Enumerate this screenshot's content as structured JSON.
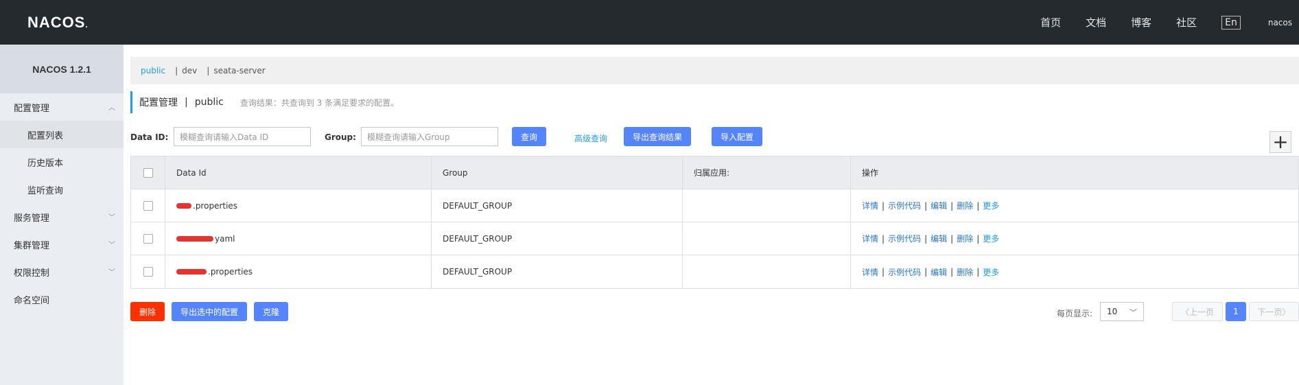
{
  "header": {
    "logo_text": "NACOS",
    "logo_dot": ".",
    "nav": [
      "首页",
      "文档",
      "博客",
      "社区"
    ],
    "lang": "En",
    "user": "nacos"
  },
  "sidebar": {
    "title": "NACOS 1.2.1",
    "items": [
      {
        "label": "配置管理",
        "level": 0,
        "expanded": true
      },
      {
        "label": "配置列表",
        "level": 1,
        "active": true
      },
      {
        "label": "历史版本",
        "level": 1
      },
      {
        "label": "监听查询",
        "level": 1
      },
      {
        "label": "服务管理",
        "level": 0
      },
      {
        "label": "集群管理",
        "level": 0
      },
      {
        "label": "权限控制",
        "level": 0
      },
      {
        "label": "命名空间",
        "level": 0
      }
    ]
  },
  "namespaces": {
    "items": [
      "public",
      "dev",
      "seata-server"
    ],
    "active": "public",
    "separator": "|"
  },
  "page": {
    "title": "配置管理",
    "bar": "|",
    "namespace": "public",
    "result_desc": "查询结果：共查询到 3 条满足要求的配置。"
  },
  "search": {
    "data_id_label": "Data ID:",
    "data_id_placeholder": "模糊查询请输入Data ID",
    "group_label": "Group:",
    "group_placeholder": "模糊查询请输入Group",
    "query_btn": "查询",
    "advanced_link": "高级查询",
    "export_btn": "导出查询结果",
    "import_btn": "导入配置",
    "add_icon": "+"
  },
  "table": {
    "headers": [
      "Data Id",
      "Group",
      "归属应用:",
      "操作"
    ],
    "rows": [
      {
        "data_id_suffix": ".properties",
        "group": "DEFAULT_GROUP",
        "app": ""
      },
      {
        "data_id_suffix": "yaml",
        "group": "DEFAULT_GROUP",
        "app": ""
      },
      {
        "data_id_suffix": ".properties",
        "group": "DEFAULT_GROUP",
        "app": ""
      }
    ],
    "actions": [
      "详情",
      "示例代码",
      "编辑",
      "删除",
      "更多"
    ],
    "action_sep": "|"
  },
  "footer": {
    "delete_btn": "删除",
    "export_selected_btn": "导出选中的配置",
    "clone_btn": "克隆",
    "page_size_label": "每页显示:",
    "page_size": "10",
    "prev": "上一页",
    "current_page": "1",
    "next": "下一页"
  },
  "colors": {
    "header_bg": "#252a2f",
    "sidebar_bg": "#eaedf1",
    "primary": "#5584ff",
    "danger": "#ff3000",
    "link": "#209bfa"
  }
}
